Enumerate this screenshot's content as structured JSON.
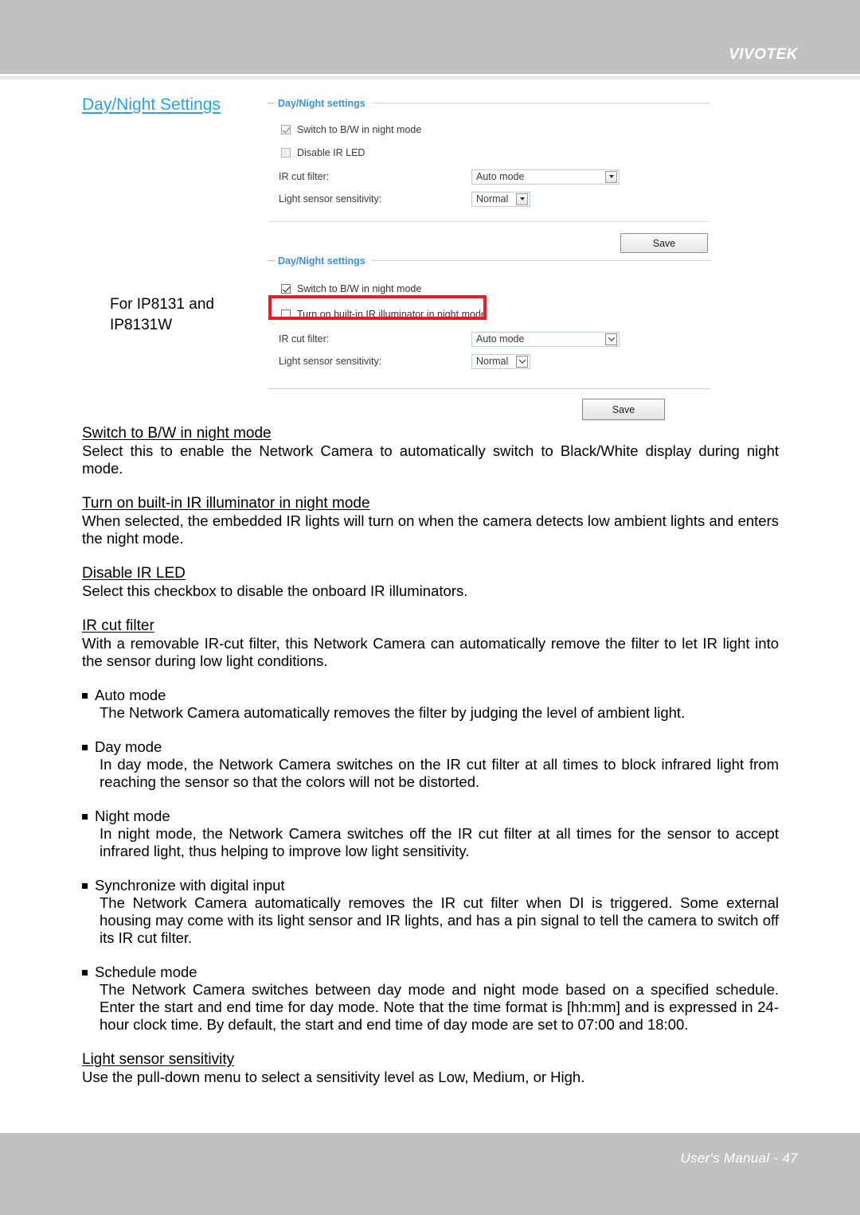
{
  "header": {
    "brand": "VIVOTEK"
  },
  "footer": {
    "text": "User's Manual - 47"
  },
  "section": {
    "title": "Day/Night Settings",
    "model_note": "For IP8131 and\nIP8131W"
  },
  "panel1": {
    "legend": "Day/Night settings",
    "checkbox_bw": {
      "label": "Switch to B/W in night mode",
      "checked": true
    },
    "checkbox_disable_ir": {
      "label": "Disable IR LED",
      "checked": false
    },
    "ir_cut_filter": {
      "label": "IR cut filter:",
      "value": "Auto mode"
    },
    "light_sensor": {
      "label": "Light sensor sensitivity:",
      "value": "Normal"
    },
    "save_label": "Save"
  },
  "panel2": {
    "legend": "Day/Night settings",
    "checkbox_bw": {
      "label": "Switch to B/W in night mode",
      "checked": true
    },
    "checkbox_ir_illuminator": {
      "label": "Turn on built-in IR illuminator in night mode",
      "checked": false
    },
    "ir_cut_filter": {
      "label": "IR cut filter:",
      "value": "Auto mode"
    },
    "light_sensor": {
      "label": "Light sensor sensitivity:",
      "value": "Normal"
    },
    "save_label": "Save",
    "highlight_color": "#ed1c24"
  },
  "content": {
    "sections": [
      {
        "heading": "Switch to B/W in night mode",
        "body": "Select this to enable the Network Camera to automatically switch to Black/White display during night mode."
      },
      {
        "heading": "Turn on built-in IR illuminator in night mode",
        "body": "When selected, the embedded IR lights will turn on when the camera detects low ambient lights and enters the night mode."
      },
      {
        "heading": "Disable IR LED",
        "body": "Select this checkbox to disable the onboard IR illuminators."
      },
      {
        "heading": "IR cut filter",
        "body": "With a removable IR-cut filter, this Network Camera can automatically remove the filter to let IR light into the sensor during low light conditions."
      }
    ],
    "bullets": [
      {
        "title": "Auto mode",
        "body": "The Network Camera automatically removes the filter by judging the level of ambient light."
      },
      {
        "title": "Day mode",
        "body": "In day mode, the Network Camera switches on the IR cut filter at all times to block infrared light from reaching the sensor so that the colors will not be distorted."
      },
      {
        "title": "Night mode",
        "body": "In night mode, the Network Camera switches off the IR cut filter at all times for the sensor to accept infrared light, thus helping to improve low light sensitivity."
      },
      {
        "title": "Synchronize with digital input",
        "body": "The Network Camera automatically removes the IR cut filter when DI is triggered. Some external housing may come with its light sensor and IR lights, and has a pin signal to tell the camera to switch off its IR cut filter."
      },
      {
        "title": "Schedule mode",
        "body": "The Network Camera switches between day mode and night mode based on a specified schedule. Enter the start and end time for day mode. Note that the time format is [hh:mm] and is expressed in 24-hour clock time. By default, the start and end time of day mode are set to 07:00 and 18:00."
      }
    ],
    "final_section": {
      "heading": "Light sensor sensitivity",
      "body": "Use the pull-down menu to select a sensitivity level as Low, Medium, or High."
    }
  }
}
